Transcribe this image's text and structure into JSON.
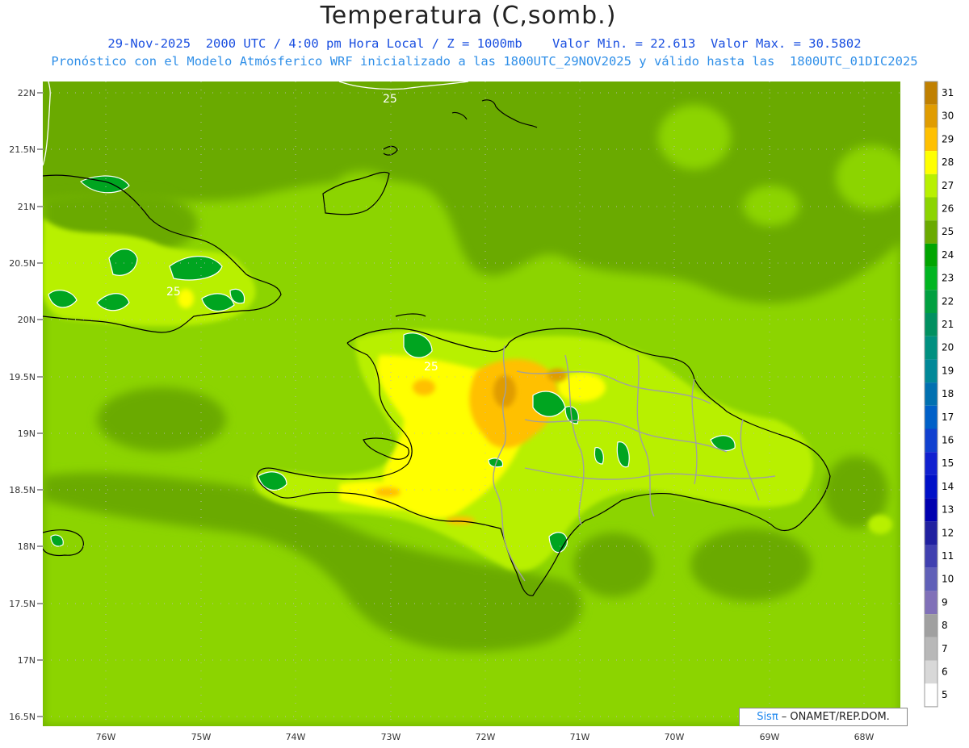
{
  "title": "Temperatura (C,somb.)",
  "subtitle1": "29-Nov-2025  2000 UTC / 4:00 pm Hora Local / Z = 1000mb    Valor Min. = 22.613  Valor Max. = 30.5802",
  "subtitle2": "Pronóstico con el Modelo Atmósferico WRF inicializado a las 1800UTC_29NOV2025 y válido hasta las  1800UTC_01DIC2025",
  "lat_labels": [
    "22N",
    "21.5N",
    "21N",
    "20.5N",
    "20N",
    "19.5N",
    "19N",
    "18.5N",
    "18N",
    "17.5N",
    "17N",
    "16.5N"
  ],
  "lon_labels": [
    "76W",
    "75W",
    "74W",
    "73W",
    "72W",
    "71W",
    "70W",
    "69W",
    "68W"
  ],
  "contour_labels": [
    "25",
    "25",
    "25"
  ],
  "colorbar": {
    "levels": [
      "31",
      "30",
      "29",
      "28",
      "27",
      "26",
      "25",
      "24",
      "23",
      "22",
      "21",
      "20",
      "19",
      "18",
      "17",
      "16",
      "15",
      "14",
      "13",
      "12",
      "11",
      "10",
      "9",
      "8",
      "7",
      "6",
      "5"
    ],
    "colors": [
      "#c08000",
      "#e09c00",
      "#ffc000",
      "#ffff00",
      "#b8f000",
      "#8cd400",
      "#6aaa00",
      "#00a500",
      "#00b520",
      "#00a040",
      "#009060",
      "#009080",
      "#008898",
      "#0070b0",
      "#0060c8",
      "#1040d0",
      "#1020d0",
      "#0010c8",
      "#0000b0",
      "#2020a0",
      "#4040b0",
      "#6060b8",
      "#8070b8",
      "#a0a0a0",
      "#b8b8b8",
      "#d8d8d8",
      "#ffffff"
    ]
  },
  "credit_brand": "Sisπ",
  "credit_text": " – ONAMET/REP.DOM."
}
